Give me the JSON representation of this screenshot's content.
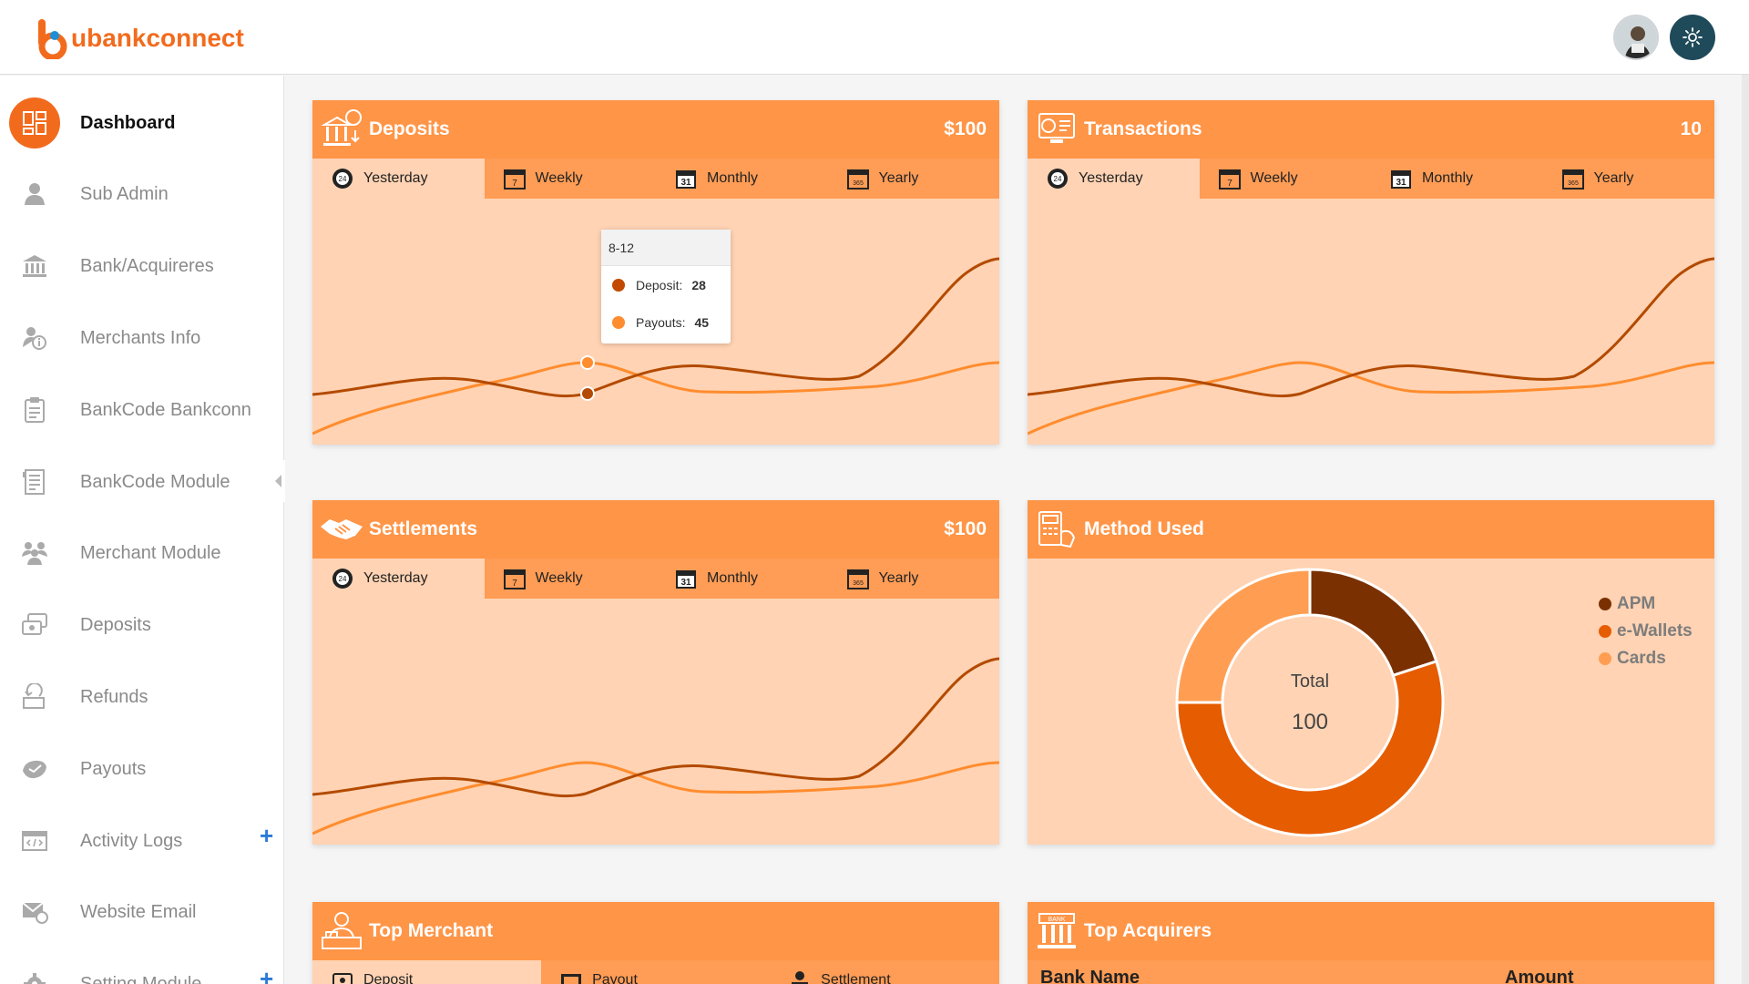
{
  "app": {
    "logo_u": "u",
    "logo_bank": "bank",
    "logo_connect": "connect"
  },
  "colors": {
    "brand": "#f26b1d",
    "header": "#ff9547",
    "tabs": "#ff9c55",
    "panel": "#ffd3b3",
    "line_dark": "#b34a00",
    "line_light": "#ff8c2e",
    "apm": "#7a3000",
    "ewallets": "#e65c00",
    "cards": "#ff9e52"
  },
  "sidebar": {
    "items": [
      {
        "label": "Dashboard",
        "icon": "dashboard-icon"
      },
      {
        "label": "Sub Admin",
        "icon": "user-icon"
      },
      {
        "label": "Bank/Acquireres",
        "icon": "bank-icon"
      },
      {
        "label": "Merchants Info",
        "icon": "merchant-info-icon"
      },
      {
        "label": "BankCode Bankconn",
        "icon": "clipboard-icon"
      },
      {
        "label": "BankCode Module",
        "icon": "document-icon"
      },
      {
        "label": "Merchant Module",
        "icon": "users-icon"
      },
      {
        "label": "Deposits",
        "icon": "deposit-icon"
      },
      {
        "label": "Refunds",
        "icon": "refund-icon"
      },
      {
        "label": "Payouts",
        "icon": "payout-icon"
      },
      {
        "label": "Activity Logs",
        "icon": "code-window-icon"
      },
      {
        "label": "Website Email",
        "icon": "email-icon"
      },
      {
        "label": "Setting Module",
        "icon": "gear-icon"
      }
    ],
    "expand_symbol": "+"
  },
  "tabs": {
    "yesterday": "Yesterday",
    "weekly": "Weekly",
    "monthly": "Monthly",
    "yearly": "Yearly"
  },
  "deposits": {
    "title": "Deposits",
    "value": "$100"
  },
  "transactions": {
    "title": "Transactions",
    "value": "10"
  },
  "settlements": {
    "title": "Settlements",
    "value": "$100"
  },
  "method_used": {
    "title": "Method Used",
    "total_label": "Total",
    "total_value": "100",
    "legend": [
      "APM",
      "e-Wallets",
      "Cards"
    ]
  },
  "tooltip": {
    "title": "8-12",
    "deposit_label": "Deposit:",
    "deposit_value": "28",
    "payouts_label": "Payouts:",
    "payouts_value": "45"
  },
  "top_merchant": {
    "title": "Top Merchant",
    "tabs": [
      "Deposit",
      "Payout",
      "Settlement"
    ]
  },
  "top_acquirers": {
    "title": "Top Acquirers",
    "col_bank": "Bank Name",
    "col_amount": "Amount"
  },
  "chart_data": [
    {
      "type": "area",
      "title": "Deposits",
      "series": [
        {
          "name": "Deposit",
          "values": [
            28
          ]
        },
        {
          "name": "Payouts",
          "values": [
            45
          ]
        }
      ],
      "categories": [
        "8-12"
      ]
    },
    {
      "type": "pie",
      "title": "Method Used",
      "categories": [
        "APM",
        "e-Wallets",
        "Cards"
      ],
      "values": [
        20,
        55,
        25
      ]
    }
  ]
}
